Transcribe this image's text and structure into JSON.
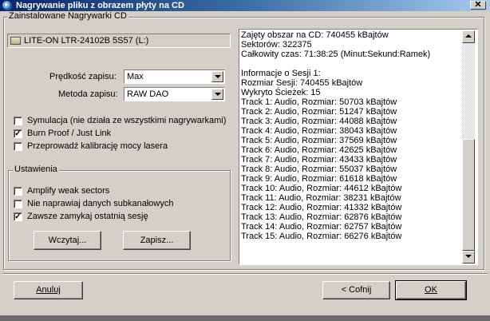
{
  "window": {
    "title": "Nagrywanie pliku z obrazem płyty na CD",
    "close_glyph": "✕"
  },
  "left": {
    "group_title": "Zainstalowane Nagrywarki CD",
    "drive": "LITE-ON LTR-24102B 5S57 (L:)",
    "speed_label": "Prędkość zapisu:",
    "speed_value": "Max",
    "method_label": "Metoda zapisu:",
    "method_value": "RAW DAO",
    "options": [
      {
        "label": "Symulacja (nie działa ze wszystkimi nagrywarkami)",
        "checked": false
      },
      {
        "label": "Burn Proof / Just Link",
        "checked": true
      },
      {
        "label": "Przeprowadź kalibrację mocy lasera",
        "checked": false
      }
    ],
    "settings_title": "Ustawienia",
    "settings": [
      {
        "label": "Amplify weak sectors",
        "checked": false
      },
      {
        "label": "Nie naprawiaj danych subkanałowych",
        "checked": false
      },
      {
        "label": "Zawsze zamykaj ostatnią sesję",
        "checked": true
      }
    ],
    "load_button": "Wczytaj...",
    "save_button": "Zapisz..."
  },
  "log": [
    "Zajęty obszar na CD: 740455 kBajtów",
    "Sektorów: 322375",
    "Całkowity czas: 71:38:25 (Minut:Sekund:Ramek)",
    "",
    "Informacje o Sesji 1:",
    "Rozmiar Sesji: 740455 kBajtów",
    "Wykryto Ścieżek: 15",
    "Track 1: Audio, Rozmiar: 50703 kBajtów",
    "Track 2: Audio, Rozmiar: 51247 kBajtów",
    "Track 3: Audio, Rozmiar: 44088 kBajtów",
    "Track 4: Audio, Rozmiar: 38043 kBajtów",
    "Track 5: Audio, Rozmiar: 37569 kBajtów",
    "Track 6: Audio, Rozmiar: 42625 kBajtów",
    "Track 7: Audio, Rozmiar: 43433 kBajtów",
    "Track 8: Audio, Rozmiar: 55037 kBajtów",
    "Track 9: Audio, Rozmiar: 61618 kBajtów",
    "Track 10: Audio, Rozmiar: 44612 kBajtów",
    "Track 11: Audio, Rozmiar: 38231 kBajtów",
    "Track 12: Audio, Rozmiar: 41332 kBajtów",
    "Track 13: Audio, Rozmiar: 62876 kBajtów",
    "Track 14: Audio, Rozmiar: 62757 kBajtów",
    "Track 15: Audio, Rozmiar: 66276 kBajtów"
  ],
  "buttons": {
    "cancel": "Anuluj",
    "back": "< Cofnij",
    "ok": "OK"
  },
  "colors": {
    "title_start": "#0a246a",
    "title_end": "#a6caf0",
    "face": "#d4d0c8"
  }
}
